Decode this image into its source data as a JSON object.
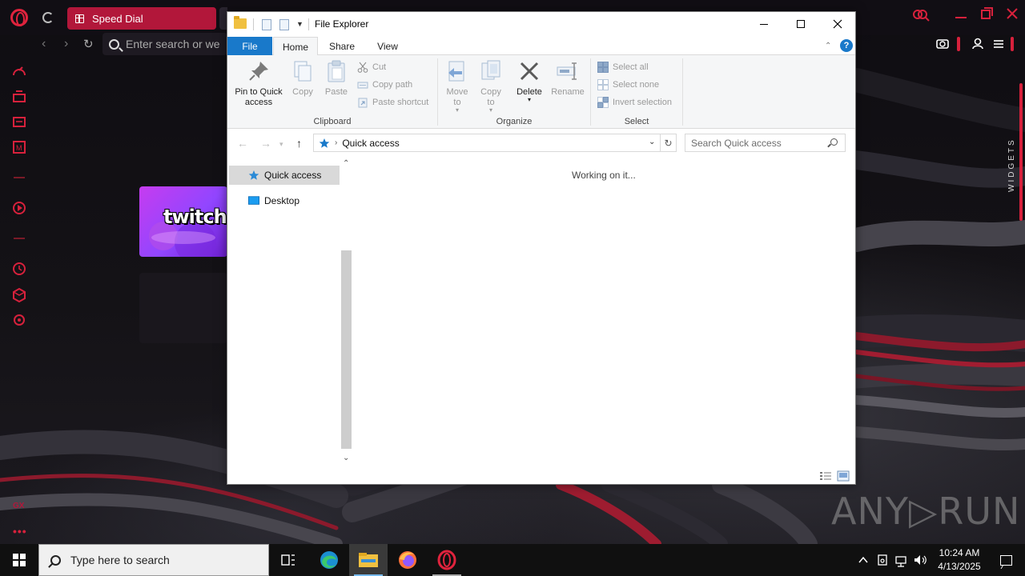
{
  "browser": {
    "active_tab_label": "Speed Dial",
    "address_placeholder": "Enter search or we",
    "speed_dial_tile": "twitch",
    "widgets_label": "WIDGETS",
    "sidebar_bottom_label": "GX",
    "more_label": "•••",
    "accent_color": "#d7213c"
  },
  "watermark": {
    "text": "ANY▷RUN"
  },
  "explorer": {
    "title": "File Explorer",
    "ribbon_tabs": [
      {
        "label": "File"
      },
      {
        "label": "Home"
      },
      {
        "label": "Share"
      },
      {
        "label": "View"
      }
    ],
    "help_label": "?",
    "clipboard": {
      "group_label": "Clipboard",
      "pin_label": "Pin to Quick access",
      "copy_label": "Copy",
      "paste_label": "Paste",
      "cut_label": "Cut",
      "copy_path_label": "Copy path",
      "paste_shortcut_label": "Paste shortcut"
    },
    "organize": {
      "group_label": "Organize",
      "move_to_label": "Move to",
      "copy_to_label": "Copy to",
      "delete_label": "Delete",
      "rename_label": "Rename"
    },
    "select": {
      "group_label": "Select",
      "select_all_label": "Select all",
      "select_none_label": "Select none",
      "invert_selection_label": "Invert selection"
    },
    "address": {
      "path_label": "Quick access"
    },
    "search": {
      "placeholder": "Search Quick access"
    },
    "nav_pane": [
      {
        "label": "Quick access",
        "icon": "star-icon",
        "selected": true
      },
      {
        "label": "Desktop",
        "icon": "desktop-folder-icon",
        "selected": false
      }
    ],
    "status_message": "Working on it..."
  },
  "taskbar": {
    "search_placeholder": "Type here to search",
    "apps": [
      {
        "name": "Task View",
        "icon": "task-view-icon"
      },
      {
        "name": "Microsoft Edge",
        "icon": "edge-icon"
      },
      {
        "name": "File Explorer",
        "icon": "file-explorer-icon",
        "active": true
      },
      {
        "name": "Firefox",
        "icon": "firefox-icon"
      },
      {
        "name": "Opera GX",
        "icon": "opera-gx-icon"
      }
    ],
    "clock_time": "10:24 AM",
    "clock_date": "4/13/2025"
  }
}
